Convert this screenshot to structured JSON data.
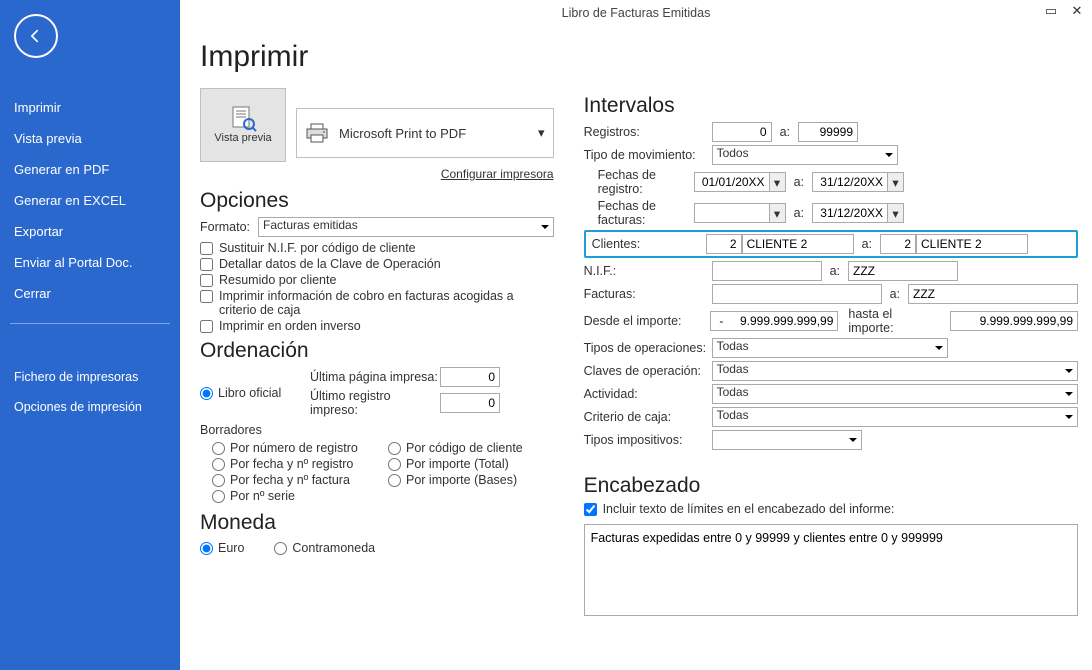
{
  "window": {
    "title": "Libro de Facturas Emitidas"
  },
  "sidebar": {
    "items": [
      "Imprimir",
      "Vista previa",
      "Generar en PDF",
      "Generar en EXCEL",
      "Exportar",
      "Enviar al Portal Doc.",
      "Cerrar"
    ],
    "footer_items": [
      "Fichero de impresoras",
      "Opciones de impresión"
    ]
  },
  "header": {
    "title": "Imprimir"
  },
  "preview": {
    "label": "Vista previa",
    "printer": "Microsoft Print to PDF"
  },
  "links": {
    "config_printer": "Configurar impresora"
  },
  "opciones": {
    "heading": "Opciones",
    "formato_label": "Formato:",
    "formato_value": "Facturas emitidas",
    "checks": [
      "Sustituir N.I.F. por código de cliente",
      "Detallar datos de la Clave de Operación",
      "Resumido por cliente",
      "Imprimir información de cobro en facturas acogidas a criterio de caja",
      "Imprimir en orden inverso"
    ]
  },
  "ordenacion": {
    "heading": "Ordenación",
    "libro_oficial": "Libro oficial",
    "ult_pagina_label": "Última página impresa:",
    "ult_pagina_value": "0",
    "ult_registro_label": "Último registro impreso:",
    "ult_registro_value": "0",
    "borradores_label": "Borradores",
    "cols_left": [
      "Por número de registro",
      "Por fecha y nº registro",
      "Por fecha y nº factura",
      "Por nº serie"
    ],
    "cols_right": [
      "Por código de cliente",
      "Por importe (Total)",
      "Por importe (Bases)"
    ]
  },
  "moneda": {
    "heading": "Moneda",
    "euro": "Euro",
    "contra": "Contramoneda"
  },
  "intervalos": {
    "heading": "Intervalos",
    "registros_label": "Registros:",
    "registros_from": "0",
    "a": "a:",
    "registros_to": "99999",
    "tipo_mov_label": "Tipo de movimiento:",
    "tipo_mov_value": "Todos",
    "fechas_reg_label": "Fechas de registro:",
    "fechas_reg_from": "01/01/20XX",
    "fechas_reg_to": "31/12/20XX",
    "fechas_fac_label": "Fechas de facturas:",
    "fechas_fac_from": "",
    "fechas_fac_to": "31/12/20XX",
    "clientes_label": "Clientes:",
    "clientes_from_code": "2",
    "clientes_from_name": "CLIENTE 2",
    "clientes_to_code": "2",
    "clientes_to_name": "CLIENTE 2",
    "nif_label": "N.I.F.:",
    "nif_from": "",
    "nif_to": "ZZZ",
    "facturas_label": "Facturas:",
    "facturas_from": "",
    "facturas_to": "ZZZ",
    "desde_imp_label": "Desde el importe:",
    "desde_imp_value": "-     9.999.999.999,99",
    "hasta_imp_label": "hasta el importe:",
    "hasta_imp_value": "9.999.999.999,99",
    "tipos_op_label": "Tipos de operaciones:",
    "tipos_op_value": "Todas",
    "claves_op_label": "Claves de operación:",
    "claves_op_value": "Todas",
    "actividad_label": "Actividad:",
    "actividad_value": "Todas",
    "criterio_caja_label": "Criterio de caja:",
    "criterio_caja_value": "Todas",
    "tipos_imp_label": "Tipos impositivos:",
    "tipos_imp_value": ""
  },
  "encabezado": {
    "heading": "Encabezado",
    "check_label": "Incluir texto de límites en el encabezado del informe:",
    "text": "Facturas expedidas entre 0 y 99999 y clientes entre 0 y 999999"
  }
}
